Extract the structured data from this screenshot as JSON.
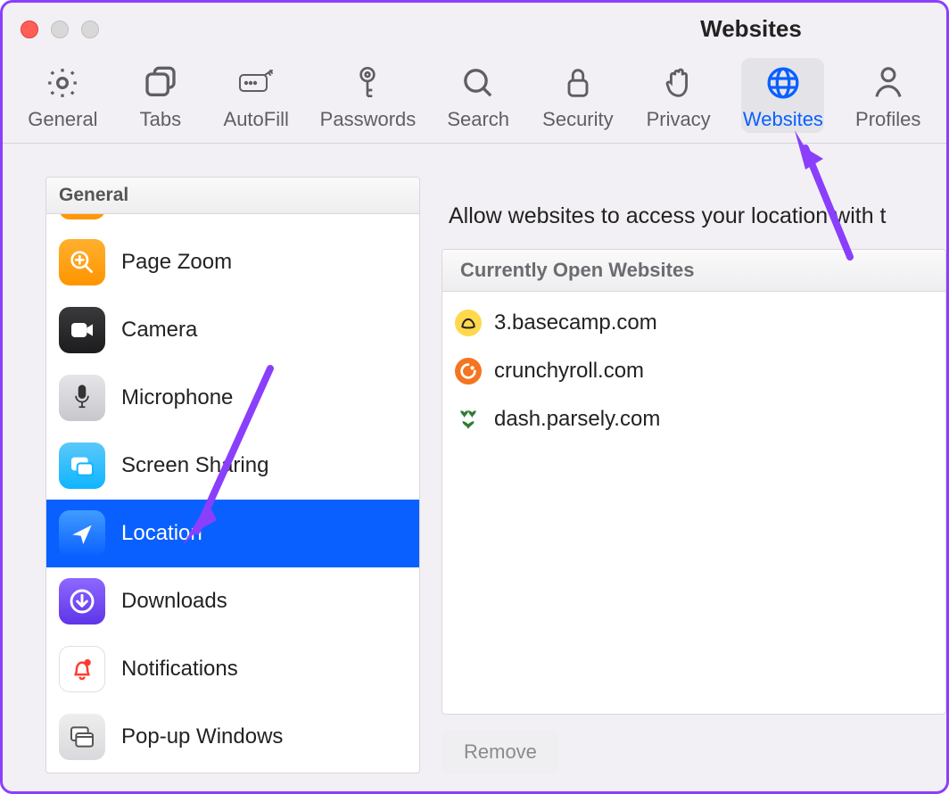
{
  "window": {
    "title": "Websites"
  },
  "toolbar": {
    "items": [
      {
        "id": "general",
        "label": "General"
      },
      {
        "id": "tabs",
        "label": "Tabs"
      },
      {
        "id": "autofill",
        "label": "AutoFill"
      },
      {
        "id": "passwords",
        "label": "Passwords"
      },
      {
        "id": "search",
        "label": "Search"
      },
      {
        "id": "security",
        "label": "Security"
      },
      {
        "id": "privacy",
        "label": "Privacy"
      },
      {
        "id": "websites",
        "label": "Websites",
        "active": true
      },
      {
        "id": "profiles",
        "label": "Profiles"
      }
    ]
  },
  "sidebar": {
    "section_label": "General",
    "items": [
      {
        "label": "",
        "icon": "orange",
        "cut": true
      },
      {
        "label": "Page Zoom",
        "icon": "orange"
      },
      {
        "label": "Camera",
        "icon": "darkgrey"
      },
      {
        "label": "Microphone",
        "icon": "grey"
      },
      {
        "label": "Screen Sharing",
        "icon": "cyan"
      },
      {
        "label": "Location",
        "icon": "blue",
        "selected": true
      },
      {
        "label": "Downloads",
        "icon": "purple"
      },
      {
        "label": "Notifications",
        "icon": "white"
      },
      {
        "label": "Pop-up Windows",
        "icon": "lightgrey"
      }
    ]
  },
  "right": {
    "heading": "Allow websites to access your location with t",
    "list_header": "Currently Open Websites",
    "sites": [
      {
        "domain": "3.basecamp.com",
        "icon": "basecamp"
      },
      {
        "domain": "crunchyroll.com",
        "icon": "cr"
      },
      {
        "domain": "dash.parsely.com",
        "icon": "parsely"
      }
    ],
    "remove_label": "Remove"
  }
}
